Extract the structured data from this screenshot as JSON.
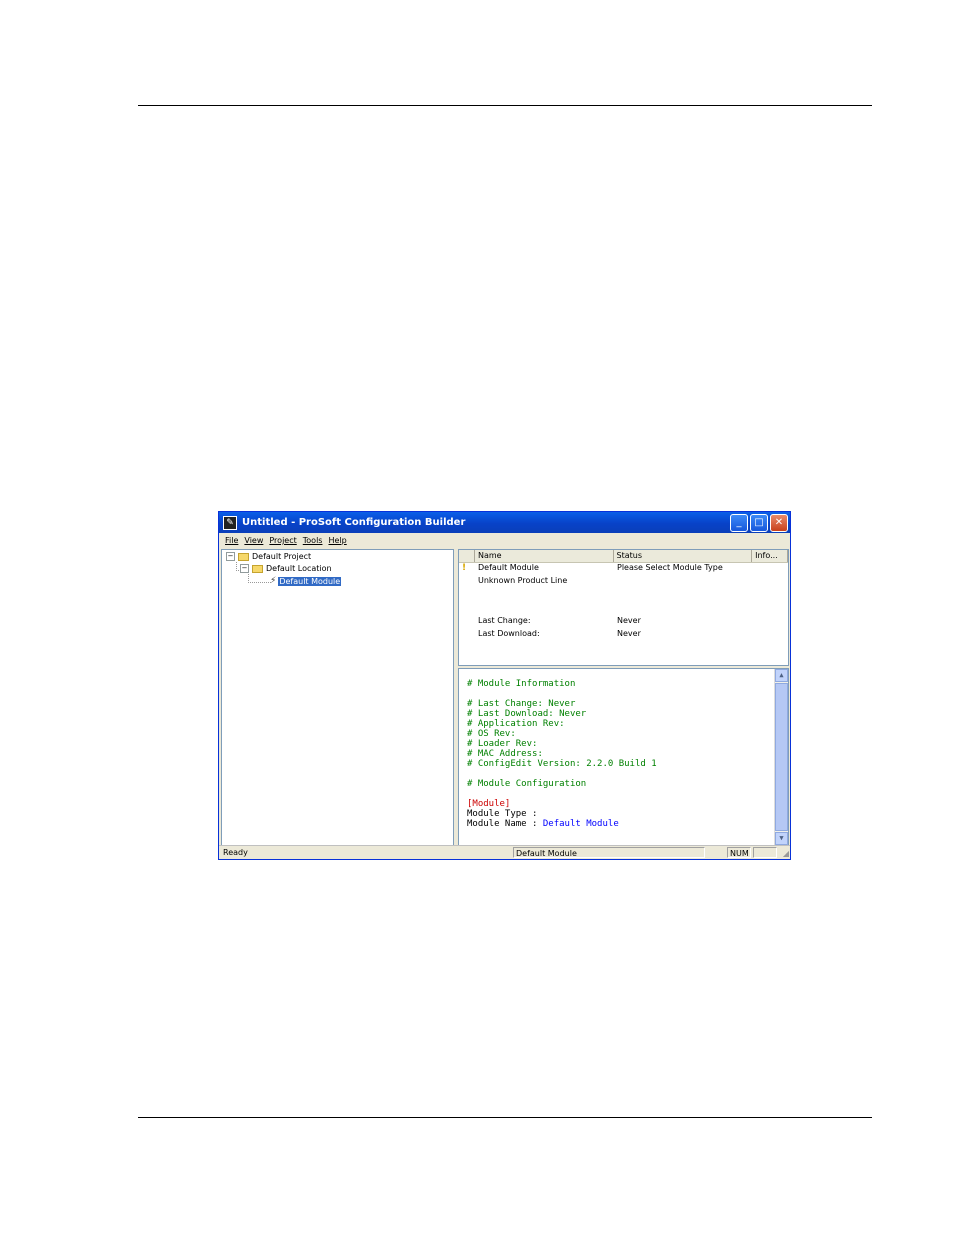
{
  "window": {
    "title": "Untitled - ProSoft Configuration Builder",
    "app_icon": "prosoft-app-icon",
    "buttons": {
      "minimize": "_",
      "maximize": "□",
      "close": "✕"
    }
  },
  "menu": [
    "File",
    "View",
    "Project",
    "Tools",
    "Help"
  ],
  "tree": {
    "project": "Default Project",
    "location": "Default Location",
    "module": "Default Module",
    "expander_glyph": "−"
  },
  "list": {
    "columns": [
      "Name",
      "Status",
      "Info..."
    ],
    "rows": [
      {
        "name": "Default Module",
        "status": "Please Select Module Type"
      },
      {
        "name": "Unknown Product Line",
        "status": ""
      },
      {
        "name": "Last Change:",
        "status": "Never"
      },
      {
        "name": "Last Download:",
        "status": "Never"
      }
    ]
  },
  "config_text": {
    "module_info_header": "# Module Information",
    "last_change": "# Last Change: Never",
    "last_download": "# Last Download: Never",
    "app_rev": "# Application Rev:",
    "os_rev": "# OS Rev:",
    "loader_rev": "# Loader Rev:",
    "mac": "# MAC Address:",
    "configedit": "# ConfigEdit Version: 2.2.0 Build 1",
    "module_config_header": "# Module Configuration",
    "section": "[Module]",
    "module_type_key": "Module Type :",
    "module_name_key": "Module Name :",
    "module_name_value": "Default Module"
  },
  "status": {
    "left": "Ready",
    "middle": "Default Module",
    "num": "NUM"
  },
  "colors": {
    "titlebar": "#0842c8",
    "selection": "#316ac5",
    "comment_green": "#008000",
    "section_red": "#cc0000",
    "value_blue": "#0000ff"
  }
}
